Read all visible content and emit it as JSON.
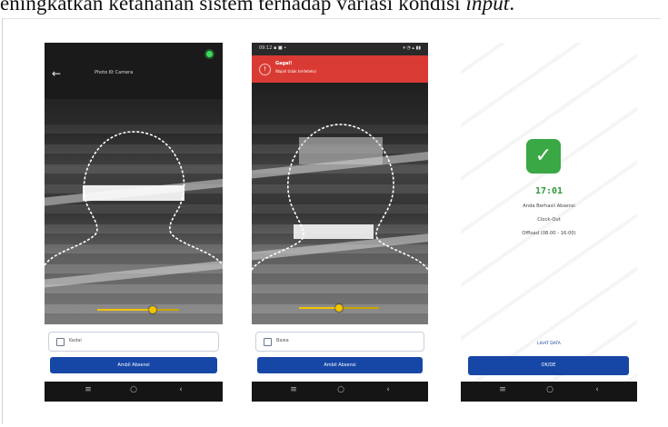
{
  "caption": {
    "text": "eningkatkan ketahanan sistem terhadap variasi kondisi ",
    "italic": "input",
    "end": "."
  },
  "screens": [
    {
      "title": "Photo Kt Camera",
      "checkbox_label": "Kedai",
      "button_label": "Ambil Absensi",
      "slider_value": 0.68
    },
    {
      "status_time": "09:12 ▪ ■ •",
      "status_icons": "▾ ◔ ▴ ▮▮",
      "error_title": "Gagal!",
      "error_message": "Wajah tidak terdeteksi",
      "checkbox_label": "Bawa",
      "button_label": "Ambil Absensi",
      "slider_value": 0.5
    },
    {
      "time": "17:01",
      "line1": "Anda Berhasil Absensi",
      "line2": "Clock-Out",
      "line3": "Offload (08.00 - 16:00)",
      "link_label": "LIHAT DATA",
      "button_label": "OK/DE"
    }
  ],
  "navbar": {
    "left": "≡",
    "home": "○",
    "back": "‹"
  },
  "icons": {
    "back": "arrow-left-icon",
    "error": "alert-icon",
    "success": "checkmark-icon"
  },
  "colors": {
    "primary": "#1747a6",
    "error": "#d93a34",
    "success": "#3aa844",
    "slider": "#f3c400"
  }
}
